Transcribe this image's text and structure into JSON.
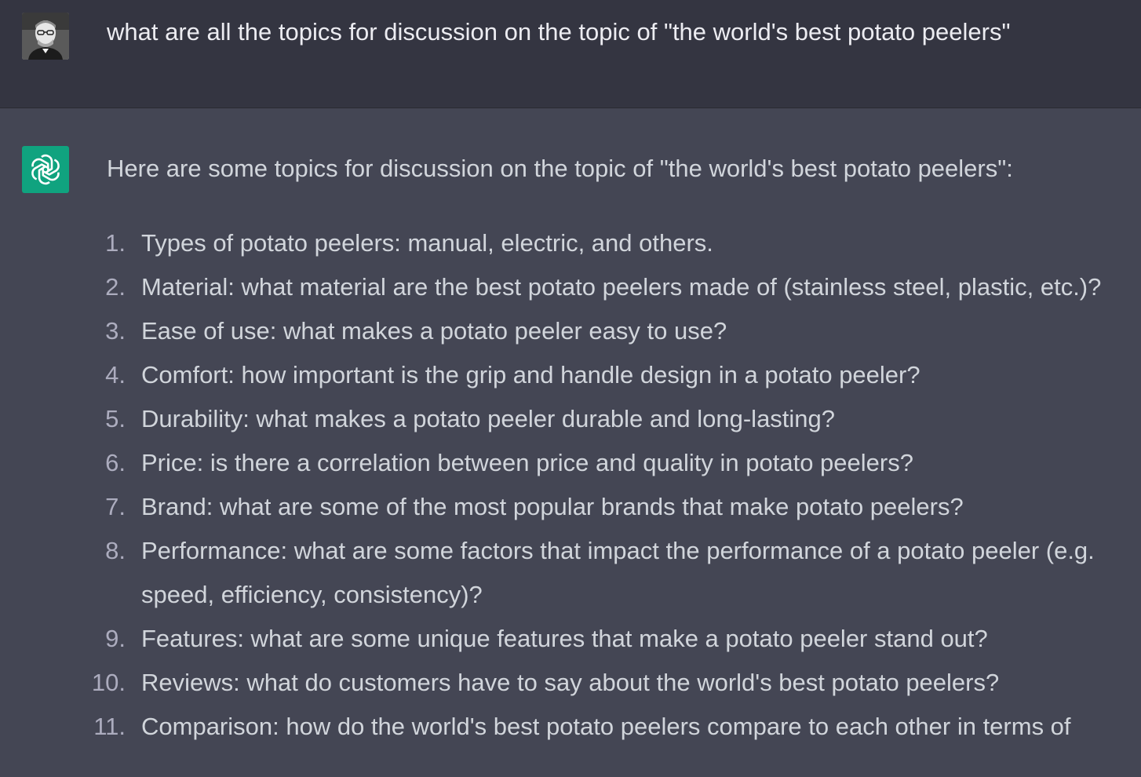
{
  "user_message": {
    "avatar_icon": "user-profile-photo",
    "text": "what are all the topics for discussion on the topic of \"the world's best potato peelers\""
  },
  "assistant_message": {
    "avatar_icon": "chatgpt-logo-icon",
    "avatar_color": "#10a37f",
    "intro": "Here are some topics for discussion on the topic of \"the world's best potato peelers\":",
    "items": [
      {
        "num": "1.",
        "text": "Types of potato peelers: manual, electric, and others."
      },
      {
        "num": "2.",
        "text": "Material: what material are the best potato peelers made of (stainless steel, plastic, etc.)?"
      },
      {
        "num": "3.",
        "text": "Ease of use: what makes a potato peeler easy to use?"
      },
      {
        "num": "4.",
        "text": "Comfort: how important is the grip and handle design in a potato peeler?"
      },
      {
        "num": "5.",
        "text": "Durability: what makes a potato peeler durable and long-lasting?"
      },
      {
        "num": "6.",
        "text": "Price: is there a correlation between price and quality in potato peelers?"
      },
      {
        "num": "7.",
        "text": "Brand: what are some of the most popular brands that make potato peelers?"
      },
      {
        "num": "8.",
        "text": "Performance: what are some factors that impact the performance of a potato peeler (e.g. speed, efficiency, consistency)?"
      },
      {
        "num": "9.",
        "text": "Features: what are some unique features that make a potato peeler stand out?"
      },
      {
        "num": "10.",
        "text": "Reviews: what do customers have to say about the world's best potato peelers?"
      },
      {
        "num": "11.",
        "text": "Comparison: how do the world's best potato peelers compare to each other in terms of"
      }
    ]
  },
  "colors": {
    "user_bg": "#343541",
    "assistant_bg": "#444654",
    "text": "#d1d5db"
  }
}
